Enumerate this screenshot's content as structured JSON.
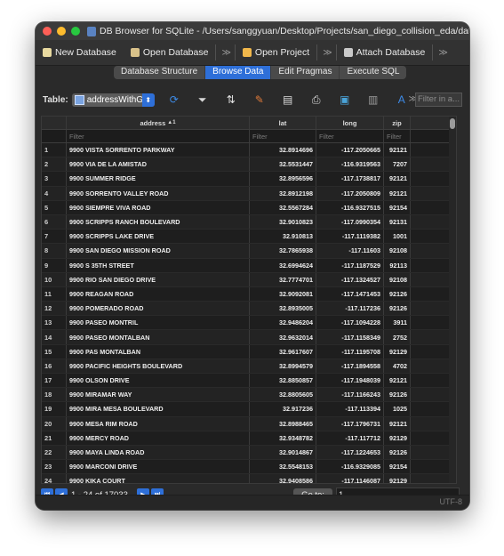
{
  "window": {
    "title": "DB Browser for SQLite - /Users/sanggyuan/Desktop/Projects/san_diego_collision_eda/data/uniq..."
  },
  "toolbar": {
    "new_database": "New Database",
    "open_database": "Open Database",
    "open_project": "Open Project",
    "attach_database": "Attach Database",
    "overflow": "≫"
  },
  "tabs": {
    "structure": "Database Structure",
    "browse": "Browse Data",
    "pragmas": "Edit Pragmas",
    "sql": "Execute SQL"
  },
  "browse": {
    "table_label": "Table:",
    "table_name": "addressWithGe",
    "filter_placeholder": "Filter in a..."
  },
  "grid": {
    "columns": [
      "address",
      "lat",
      "long",
      "zip"
    ],
    "sort_indicator": "▲1",
    "filter_text": "Filter",
    "rows": [
      [
        "1",
        "9900 VISTA SORRENTO PARKWAY",
        "32.8914696",
        "-117.2050665",
        "92121"
      ],
      [
        "2",
        "9900 VIA DE LA AMISTAD",
        "32.5531447",
        "-116.9319563",
        "7207"
      ],
      [
        "3",
        "9900 SUMMER RIDGE",
        "32.8956596",
        "-117.1738817",
        "92121"
      ],
      [
        "4",
        "9900 SORRENTO VALLEY ROAD",
        "32.8912198",
        "-117.2050809",
        "92121"
      ],
      [
        "5",
        "9900 SIEMPRE VIVA ROAD",
        "32.5567284",
        "-116.9327515",
        "92154"
      ],
      [
        "6",
        "9900 SCRIPPS RANCH BOULEVARD",
        "32.9010823",
        "-117.0990354",
        "92131"
      ],
      [
        "7",
        "9900 SCRIPPS LAKE DRIVE",
        "32.910813",
        "-117.1119382",
        "1001"
      ],
      [
        "8",
        "9900 SAN DIEGO MISSION ROAD",
        "32.7865938",
        "-117.11603",
        "92108"
      ],
      [
        "9",
        "9900 S 35TH STREET",
        "32.6994624",
        "-117.1187529",
        "92113"
      ],
      [
        "10",
        "9900 RIO SAN DIEGO DRIVE",
        "32.7774701",
        "-117.1324527",
        "92108"
      ],
      [
        "11",
        "9900 REAGAN ROAD",
        "32.9092081",
        "-117.1471453",
        "92126"
      ],
      [
        "12",
        "9900 POMERADO ROAD",
        "32.8935005",
        "-117.117236",
        "92126"
      ],
      [
        "13",
        "9900 PASEO MONTRIL",
        "32.9486204",
        "-117.1094228",
        "3911"
      ],
      [
        "14",
        "9900 PASEO MONTALBAN",
        "32.9632014",
        "-117.1158349",
        "2752"
      ],
      [
        "15",
        "9900 PAS MONTALBAN",
        "32.9617607",
        "-117.1195708",
        "92129"
      ],
      [
        "16",
        "9900 PACIFIC HEIGHTS BOULEVARD",
        "32.8994579",
        "-117.1894558",
        "4702"
      ],
      [
        "17",
        "9900 OLSON DRIVE",
        "32.8850857",
        "-117.1948039",
        "92121"
      ],
      [
        "18",
        "9900 MIRAMAR WAY",
        "32.8805605",
        "-117.1166243",
        "92126"
      ],
      [
        "19",
        "9900 MIRA MESA BOULEVARD",
        "32.917236",
        "-117.113394",
        "1025"
      ],
      [
        "20",
        "9900 MESA RIM ROAD",
        "32.8988465",
        "-117.1796731",
        "92121"
      ],
      [
        "21",
        "9900 MERCY ROAD",
        "32.9348782",
        "-117.117712",
        "92129"
      ],
      [
        "22",
        "9900 MAYA LINDA ROAD",
        "32.9014867",
        "-117.1224653",
        "92126"
      ],
      [
        "23",
        "9900 MARCONI DRIVE",
        "32.5548153",
        "-116.9329085",
        "92154"
      ],
      [
        "24",
        "9900 KIKA COURT",
        "32.9408586",
        "-117.1146087",
        "92129"
      ]
    ]
  },
  "pager": {
    "range_text": "1 - 24 of 17033",
    "goto_label": "Go to:",
    "goto_value": "1"
  },
  "status": {
    "encoding": "UTF-8"
  },
  "colors": {
    "accent": "#2e6fd8",
    "background": "#1e1e1e"
  }
}
